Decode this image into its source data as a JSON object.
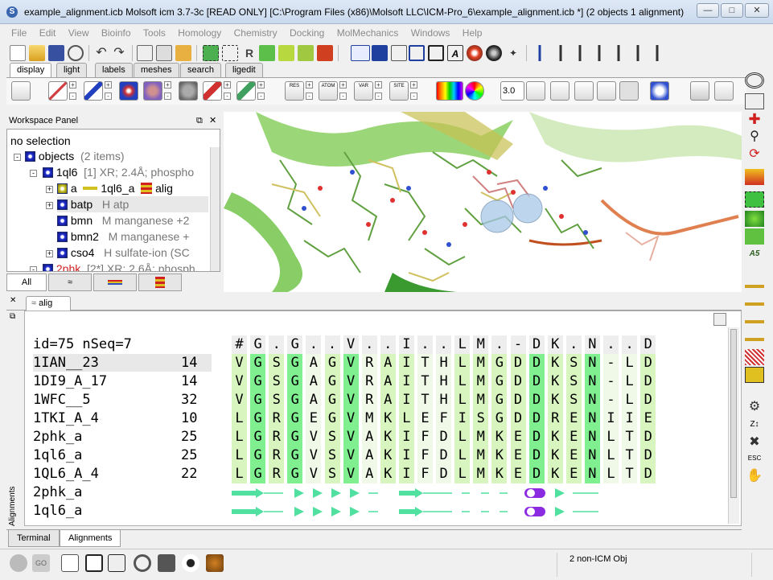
{
  "window": {
    "title": "example_alignment.icb Molsoft icm 3.7-3c [READ ONLY]  [C:\\Program Files (x86)\\Molsoft LLC\\ICM-Pro_6\\example_alignment.icb *] (2 objects 1 alignment)",
    "minimize": "—",
    "maximize": "□",
    "close": "✕"
  },
  "menu": [
    "File",
    "Edit",
    "View",
    "Bioinfo",
    "Tools",
    "Homology",
    "Chemistry",
    "Docking",
    "MolMechanics",
    "Windows",
    "Help"
  ],
  "panel_tabs": [
    "display",
    "light",
    "labels",
    "meshes",
    "search",
    "ligedit"
  ],
  "toolbar2": {
    "stat_labels": [
      "RES",
      "ATOM",
      "VAR",
      "SITE"
    ],
    "distance_value": "3.0"
  },
  "workspace": {
    "title": "Workspace Panel",
    "selection": "no selection",
    "rows": [
      {
        "name": "objects",
        "info": "(2 items)"
      },
      {
        "name": "1ql6",
        "info": "[1] XR; 2.4Å; phospho"
      },
      {
        "name": "a",
        "info": "1ql6_a",
        "extra": "alig"
      },
      {
        "name": "batp",
        "info": "H  atp"
      },
      {
        "name": "bmn",
        "info": "M  manganese +2"
      },
      {
        "name": "bmn2",
        "info": "M  manganese +"
      },
      {
        "name": "cso4",
        "info": "H  sulfate-ion (SC"
      },
      {
        "name": "2phk",
        "info": "[2*] XR; 2.6Å; phosph"
      }
    ],
    "tabs": [
      "All",
      "",
      "",
      ""
    ]
  },
  "alignment_tab": "alig",
  "alignment": {
    "header_left": "id=75 nSeq=7",
    "consensus": [
      "#",
      "G",
      ".",
      "G",
      ".",
      ".",
      "V",
      ".",
      ".",
      "I",
      ".",
      ".",
      "L",
      "M",
      ".",
      "-",
      "D",
      "K",
      ".",
      "N",
      ".",
      ".",
      "D"
    ],
    "sequences": [
      {
        "name": "1IAN__23",
        "start": "14",
        "seq": "VGSGAGVRAITHLMGDDKSN-LD"
      },
      {
        "name": "1DI9_A_17",
        "start": "14",
        "seq": "VGSGAGVRAITHLMGDDKSN-LD"
      },
      {
        "name": "1WFC__5",
        "start": "32",
        "seq": "VGSGAGVRAITHLMGDDKSN-LD"
      },
      {
        "name": "1TKI_A_4",
        "start": "10",
        "seq": "LGRGEGVMKLEFISGDDRENIIE"
      },
      {
        "name": "2phk_a",
        "start": "25",
        "seq": "LGRGVSVAKIFDLMKEDKENLTD"
      },
      {
        "name": "1ql6_a",
        "start": "25",
        "seq": "LGRGVSVAKIFDLMKEDKENLTD"
      },
      {
        "name": "1QL6_A_4",
        "start": "22",
        "seq": "LGRGVSVAKIFDLMKEDKENLTD"
      }
    ],
    "ss_rows": [
      "2phk_a",
      "1ql6_a"
    ],
    "side_label": "Alignments"
  },
  "bottom_tabs": [
    "Terminal",
    "Alignments"
  ],
  "status": "2 non-ICM Obj",
  "colors": {
    "conserved": "#7fef8f",
    "similar": "#d8f5c0",
    "light": "#f0f8e8",
    "helix": "#50e0a0",
    "strand": "#8a2be2"
  }
}
